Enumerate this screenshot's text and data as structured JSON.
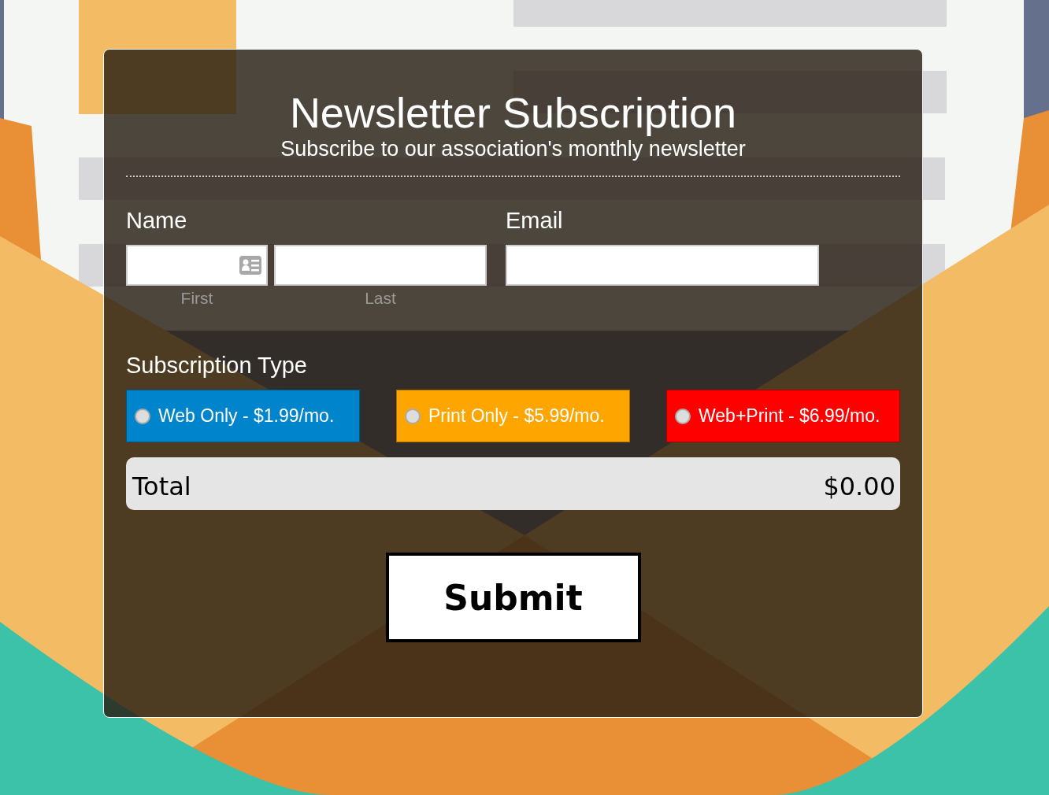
{
  "form": {
    "title": "Newsletter Subscription",
    "subtitle": "Subscribe to our association's monthly newsletter",
    "name": {
      "label": "Name",
      "first_caption": "First",
      "last_caption": "Last"
    },
    "email": {
      "label": "Email"
    },
    "subscription": {
      "label": "Subscription Type",
      "options": [
        {
          "label": "Web Only - $1.99/mo.",
          "color": "#0084cc",
          "selected": false
        },
        {
          "label": "Print Only - $5.99/mo.",
          "color": "#ffa500",
          "selected": false
        },
        {
          "label": "Web+Print - $6.99/mo.",
          "color": "#ff0000",
          "selected": false
        }
      ]
    },
    "total": {
      "label": "Total",
      "value": "$0.00"
    },
    "submit": "Submit"
  }
}
